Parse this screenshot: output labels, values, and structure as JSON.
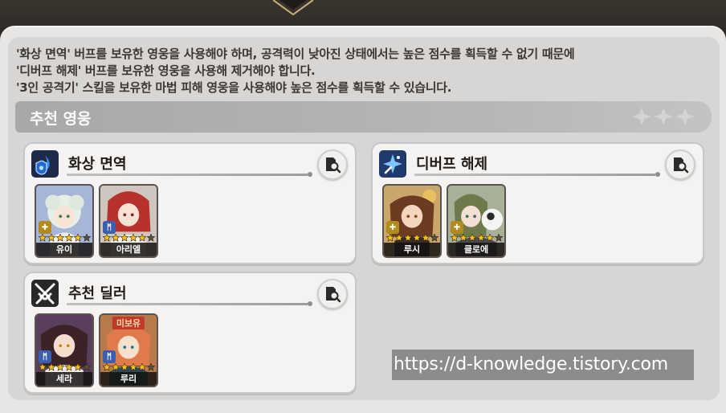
{
  "description": {
    "line1": "'화상 면역' 버프를 보유한 영웅을 사용해야 하며, 공격력이 낮아진 상태에서는 높은 점수를 획득할 수 없기 때문에",
    "line2": "'디버프 해제' 버프를 보유한 영웅을 사용해 제거해야 합니다.",
    "line3": "'3인 공격기' 스킬을 보유한 마법 피해 영웅을 사용해야 높은 점수를 획득할 수 있습니다."
  },
  "section": {
    "title": "추천 영웅"
  },
  "cards": {
    "burn_immunity": {
      "title": "화상 면역",
      "icon": "burn-immunity-icon",
      "heroes": [
        {
          "name": "유이",
          "stars": 5,
          "class": "healer"
        },
        {
          "name": "아리엘",
          "stars": 5,
          "class": "mage"
        }
      ]
    },
    "debuff_removal": {
      "title": "디버프 해제",
      "icon": "debuff-removal-icon",
      "heroes": [
        {
          "name": "루시",
          "stars": 5,
          "class": "support"
        },
        {
          "name": "클로에",
          "stars": 5,
          "class": "support"
        }
      ]
    },
    "dealer": {
      "title": "추천 딜러",
      "icon": "crossed-swords-icon",
      "heroes": [
        {
          "name": "세라",
          "stars": 5,
          "class": "mage"
        },
        {
          "name": "루리",
          "stars": 5,
          "class": "mage",
          "tag": "미보유"
        }
      ]
    }
  },
  "colors": {
    "star": "#f2c21a",
    "mage_badge": "#3a5fb0",
    "support_badge": "#b58a1c"
  },
  "watermark": "https://d-knowledge.tistory.com"
}
